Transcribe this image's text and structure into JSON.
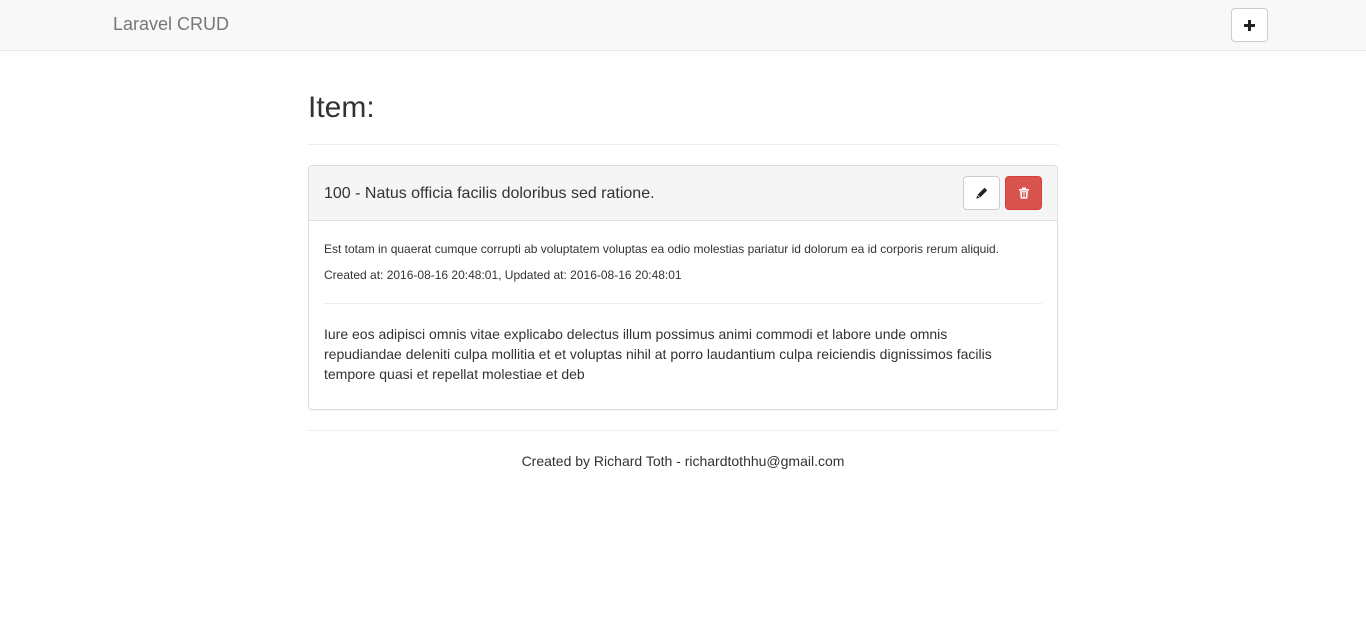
{
  "navbar": {
    "brand": "Laravel CRUD",
    "add_icon": "plus-icon"
  },
  "page": {
    "title": "Item:"
  },
  "item": {
    "heading": "100 - Natus officia facilis doloribus sed ratione.",
    "description": "Est totam in quaerat cumque corrupti ab voluptatem voluptas ea odio molestias pariatur id dolorum ea id corporis rerum aliquid.",
    "timestamps": "Created at: 2016-08-16 20:48:01, Updated at: 2016-08-16 20:48:01",
    "content": "Iure eos adipisci omnis vitae explicabo delectus illum possimus animi commodi et labore unde omnis repudiandae deleniti culpa mollitia et et voluptas nihil at porro laudantium culpa reiciendis dignissimos facilis tempore quasi et repellat molestiae et deb",
    "edit_icon": "pencil-icon",
    "delete_icon": "trash-icon"
  },
  "footer": {
    "text": "Created by Richard Toth - richardtothhu@gmail.com"
  },
  "colors": {
    "navbar_bg": "#f8f8f8",
    "danger": "#d9534f",
    "panel_heading_bg": "#f5f5f5"
  }
}
